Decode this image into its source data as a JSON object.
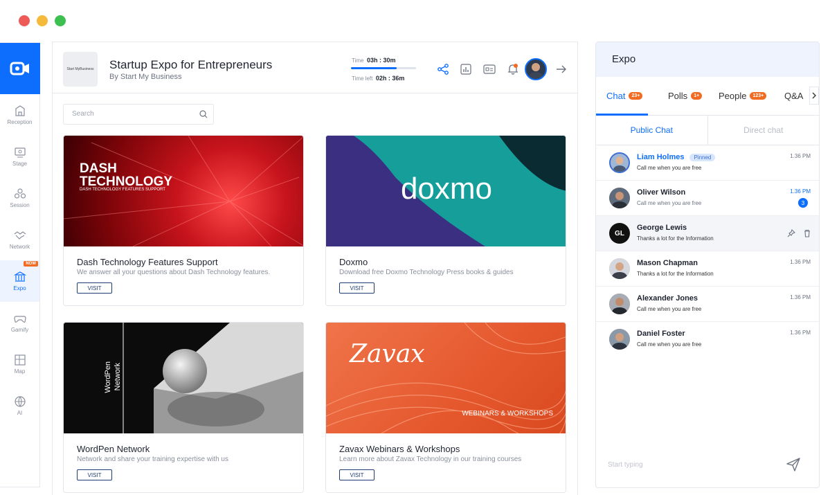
{
  "window": {
    "dots": [
      "#ee5b57",
      "#f5b93b",
      "#3dc04f"
    ]
  },
  "sidebar": {
    "items": [
      {
        "label": "Reception",
        "icon": "building-icon"
      },
      {
        "label": "Stage",
        "icon": "stage-icon"
      },
      {
        "label": "Session",
        "icon": "session-icon"
      },
      {
        "label": "Network",
        "icon": "handshake-icon"
      },
      {
        "label": "Expo",
        "icon": "expo-icon",
        "badge": "NOW",
        "active": true
      },
      {
        "label": "Gamify",
        "icon": "gamepad-icon"
      },
      {
        "label": "Map",
        "icon": "map-icon"
      },
      {
        "label": "AI",
        "icon": "ai-icon"
      }
    ]
  },
  "header": {
    "logo_text": "Start MyBusiness",
    "title": "Startup Expo for Entrepreneurs",
    "subtitle": "By Start My Business",
    "time_label": "Time",
    "time_value": "03h : 30m",
    "time_left_label": "Time left",
    "time_left_value": "02h : 36m",
    "progress": 0.7
  },
  "search": {
    "placeholder": "Search"
  },
  "cards": [
    {
      "title": "Dash Technology Features Support",
      "desc": "We answer all your questions about Dash Technology features.",
      "visit": "VISIT",
      "overlay1": "DASH",
      "overlay2": "TECHNOLOGY",
      "overlay3": "DASH TECHNOLOGY FEATURES SUPPORT"
    },
    {
      "title": "Doxmo",
      "desc": "Download free Doxmo Technology Press books & guides",
      "visit": "VISIT",
      "overlay1": "doxmo"
    },
    {
      "title": "WordPen Network",
      "desc": "Network and share your training expertise with us",
      "visit": "VISIT",
      "overlay1": "WordPen",
      "overlay2": "Network"
    },
    {
      "title": "Zavax Webinars & Workshops",
      "desc": "Learn more about Zavax Technology in our training courses",
      "visit": "VISIT",
      "overlay1": "Zavax",
      "overlay2": "WEBINARS & WORKSHOPS"
    }
  ],
  "chat": {
    "title": "Expo",
    "tabs": [
      {
        "label": "Chat",
        "badge": "23+"
      },
      {
        "label": "Polls",
        "badge": "1+"
      },
      {
        "label": "People",
        "badge": "123+"
      },
      {
        "label": "Q&A"
      }
    ],
    "subtabs": [
      "Public Chat",
      "Direct chat"
    ],
    "messages": [
      {
        "name": "Liam Holmes",
        "text": "Call me when you are free",
        "time": "1.36 PM",
        "pinned": "Pinned"
      },
      {
        "name": "Oliver Wilson",
        "text": "Call me when you are free",
        "time": "1.36 PM",
        "count": "3"
      },
      {
        "name": "George Lewis",
        "initials": "GL",
        "text": "Thanks a lot for the Information"
      },
      {
        "name": "Mason Chapman",
        "text": "Thanks a lot for the Information",
        "time": "1.36 PM"
      },
      {
        "name": "Alexander Jones",
        "text": "Call me when you are free",
        "time": "1.36 PM"
      },
      {
        "name": "Daniel Foster",
        "text": "Call me when you are free",
        "time": "1.36 PM"
      }
    ],
    "input_placeholder": "Start typing"
  }
}
